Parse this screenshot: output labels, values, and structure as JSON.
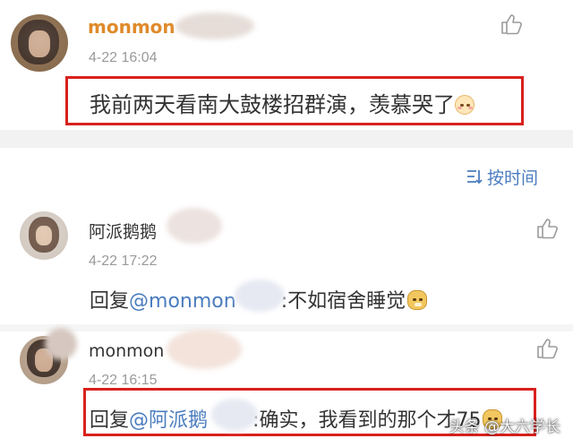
{
  "comment_main": {
    "username_visible": "monmon",
    "time": "4-22 16:04",
    "text": "我前两天看南大鼓楼招群演，羡慕哭了",
    "emoji": "blush-face-emoji"
  },
  "sort_label": "按时间",
  "replies": [
    {
      "username_visible": "阿派鹅鹅",
      "time": "4-22 17:22",
      "prefix": "回复",
      "mention": "@monmon",
      "text": ":不如宿舍睡觉",
      "emoji": "doge-emoji"
    },
    {
      "username_visible": "monmon",
      "time": "4-22 16:15",
      "prefix": "回复",
      "mention": "@阿派鹅",
      "text": ":确实，我看到的那个才75",
      "emoji": "doge-emoji"
    }
  ],
  "watermark": "头条 @大六学长",
  "colors": {
    "accent_blue": "#4a7cbf",
    "username_main": "#e08a2a",
    "highlight_red": "#d9211d"
  }
}
